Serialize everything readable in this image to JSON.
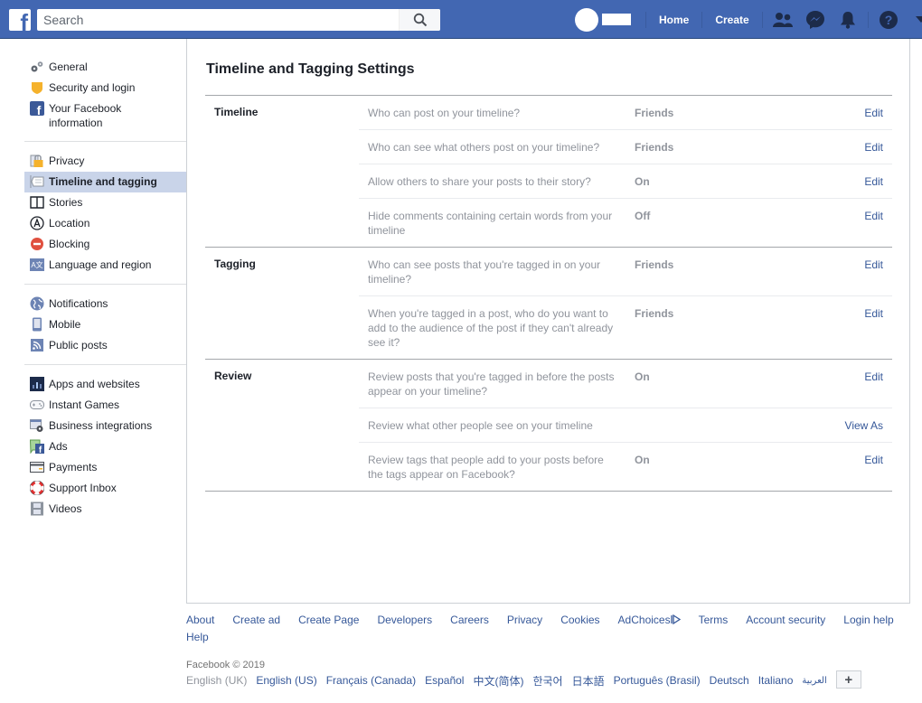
{
  "topbar": {
    "logo": "f",
    "search_placeholder": "Search",
    "nav": {
      "home": "Home",
      "create": "Create"
    },
    "icons": [
      "friends-icon",
      "messenger-icon",
      "notifications-icon",
      "help-icon",
      "account-menu-icon"
    ]
  },
  "sidebar": {
    "groups": [
      [
        {
          "label": "General",
          "icon": "gears-icon"
        },
        {
          "label": "Security and login",
          "icon": "shield-icon"
        },
        {
          "label": "Your Facebook information",
          "icon": "facebook-icon"
        }
      ],
      [
        {
          "label": "Privacy",
          "icon": "lock-icon"
        },
        {
          "label": "Timeline and tagging",
          "icon": "timeline-icon",
          "active": true
        },
        {
          "label": "Stories",
          "icon": "book-icon"
        },
        {
          "label": "Location",
          "icon": "location-icon"
        },
        {
          "label": "Blocking",
          "icon": "blocking-icon"
        },
        {
          "label": "Language and region",
          "icon": "language-icon"
        }
      ],
      [
        {
          "label": "Notifications",
          "icon": "globe-icon"
        },
        {
          "label": "Mobile",
          "icon": "mobile-icon"
        },
        {
          "label": "Public posts",
          "icon": "rss-icon"
        }
      ],
      [
        {
          "label": "Apps and websites",
          "icon": "apps-icon"
        },
        {
          "label": "Instant Games",
          "icon": "gamepad-icon"
        },
        {
          "label": "Business integrations",
          "icon": "business-icon"
        },
        {
          "label": "Ads",
          "icon": "ads-icon"
        },
        {
          "label": "Payments",
          "icon": "card-icon"
        },
        {
          "label": "Support Inbox",
          "icon": "lifebuoy-icon"
        },
        {
          "label": "Videos",
          "icon": "film-icon"
        }
      ]
    ]
  },
  "main": {
    "title": "Timeline and Tagging Settings",
    "sections": [
      {
        "label": "Timeline",
        "rows": [
          {
            "desc": "Who can post on your timeline?",
            "value": "Friends",
            "action": "Edit"
          },
          {
            "desc": "Who can see what others post on your timeline?",
            "value": "Friends",
            "action": "Edit"
          },
          {
            "desc": "Allow others to share your posts to their story?",
            "value": "On",
            "action": "Edit"
          },
          {
            "desc": "Hide comments containing certain words from your timeline",
            "value": "Off",
            "action": "Edit"
          }
        ]
      },
      {
        "label": "Tagging",
        "rows": [
          {
            "desc": "Who can see posts that you're tagged in on your timeline?",
            "value": "Friends",
            "action": "Edit"
          },
          {
            "desc": "When you're tagged in a post, who do you want to add to the audience of the post if they can't already see it?",
            "value": "Friends",
            "action": "Edit"
          }
        ]
      },
      {
        "label": "Review",
        "rows": [
          {
            "desc": "Review posts that you're tagged in before the posts appear on your timeline?",
            "value": "On",
            "action": "Edit"
          },
          {
            "desc": "Review what other people see on your timeline",
            "value": "",
            "action": "View As"
          },
          {
            "desc": "Review tags that people add to your posts before the tags appear on Facebook?",
            "value": "On",
            "action": "Edit"
          }
        ]
      }
    ]
  },
  "footer": {
    "links": [
      "About",
      "Create ad",
      "Create Page",
      "Developers",
      "Careers",
      "Privacy",
      "Cookies",
      "AdChoices",
      "Terms",
      "Account security",
      "Login help",
      "Help"
    ],
    "copyright": "Facebook © 2019",
    "languages": [
      "English (UK)",
      "English (US)",
      "Français (Canada)",
      "Español",
      "中文(简体)",
      "한국어",
      "日本語",
      "Português (Brasil)",
      "Deutsch",
      "Italiano",
      "العربية"
    ],
    "current_language": "English (UK)",
    "more_languages": "+"
  },
  "colors": {
    "brand": "#4267b2",
    "link": "#365899",
    "muted": "#90949c",
    "active_bg": "#c9d4e9"
  }
}
